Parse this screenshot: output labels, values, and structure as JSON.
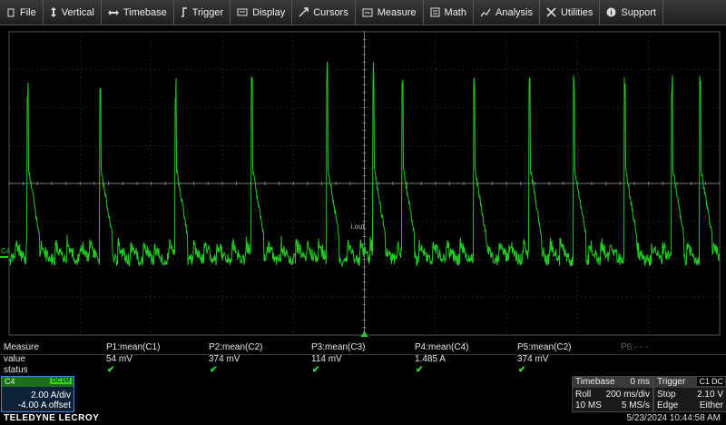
{
  "menu": [
    {
      "label": "File",
      "icon": "file-icon"
    },
    {
      "label": "Vertical",
      "icon": "vertical-icon"
    },
    {
      "label": "Timebase",
      "icon": "timebase-icon"
    },
    {
      "label": "Trigger",
      "icon": "trigger-icon"
    },
    {
      "label": "Display",
      "icon": "display-icon"
    },
    {
      "label": "Cursors",
      "icon": "cursors-icon"
    },
    {
      "label": "Measure",
      "icon": "measure-icon"
    },
    {
      "label": "Math",
      "icon": "math-icon"
    },
    {
      "label": "Analysis",
      "icon": "analysis-icon"
    },
    {
      "label": "Utilities",
      "icon": "utilities-icon"
    },
    {
      "label": "Support",
      "icon": "support-icon"
    }
  ],
  "grid": {
    "channel_marker": "C4",
    "trace_color": "#22cc22",
    "grid_color": "#3a3a3a",
    "center_label": "i.out"
  },
  "measure": {
    "header_label": "Measure",
    "value_label": "value",
    "status_label": "status",
    "params": [
      {
        "name": "P1:mean(C1)",
        "value": "54 mV",
        "status": "✔"
      },
      {
        "name": "P2:mean(C2)",
        "value": "374 mV",
        "status": "✔"
      },
      {
        "name": "P3:mean(C3)",
        "value": "114 mV",
        "status": "✔"
      },
      {
        "name": "P4:mean(C4)",
        "value": "1.485 A",
        "status": "✔"
      },
      {
        "name": "P5:mean(C2)",
        "value": "374 mV",
        "status": "✔"
      },
      {
        "name": "P6:- - -",
        "value": "",
        "status": ""
      }
    ]
  },
  "channel": {
    "name": "C4",
    "coupling": "DC1M",
    "scale": "2.00 A/div",
    "offset": "-4.00 A offset",
    "color": "#2dd22d"
  },
  "timebase": {
    "title": "Timebase",
    "delay": "0 ms",
    "mode": "Roll",
    "scale": "200 ms/div",
    "samples": "10 MS",
    "rate": "5 MS/s"
  },
  "trigger": {
    "title": "Trigger",
    "source": "C1",
    "coupling": "DC",
    "mode": "Stop",
    "level": "2.10 V",
    "type": "Edge",
    "slope": "Either"
  },
  "footer": {
    "brand": "TELEDYNE LECROY",
    "timestamp": "5/23/2024 10:44:58 AM"
  }
}
